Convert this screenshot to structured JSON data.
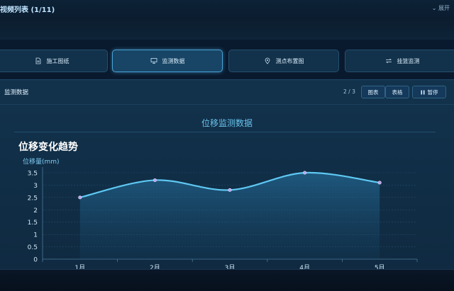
{
  "header": {
    "title": "视频列表 (1/11)",
    "expand_label": "展开"
  },
  "tabs": [
    {
      "label": "施工图纸",
      "icon": "document-icon"
    },
    {
      "label": "监测数据",
      "icon": "monitor-icon",
      "active": true
    },
    {
      "label": "测点布置图",
      "icon": "location-pin-icon"
    },
    {
      "label": "挂篮监测",
      "icon": "transfer-arrows-icon"
    }
  ],
  "panel": {
    "title": "监测数据",
    "page_indicator": "2 / 3",
    "buttons": {
      "chart": "图表",
      "table": "表格",
      "pause": "暂停"
    }
  },
  "chart_data": {
    "type": "line",
    "title": "位移监测数据",
    "subtitle": "位移变化趋势",
    "ylabel": "位移量(mm)",
    "categories": [
      "1月",
      "2月",
      "3月",
      "4月",
      "5月"
    ],
    "values": [
      2.5,
      3.2,
      2.8,
      3.5,
      3.1
    ],
    "ylim": [
      0,
      3.5
    ],
    "yticks": [
      "0",
      "0.5",
      "1",
      "1.5",
      "2",
      "2.5",
      "3",
      "3.5"
    ],
    "line_color": "#5ec8f2",
    "area_fill": true,
    "grid": true
  },
  "colors": {
    "accent": "#4aa3d6",
    "background": "#0a1a2e"
  }
}
